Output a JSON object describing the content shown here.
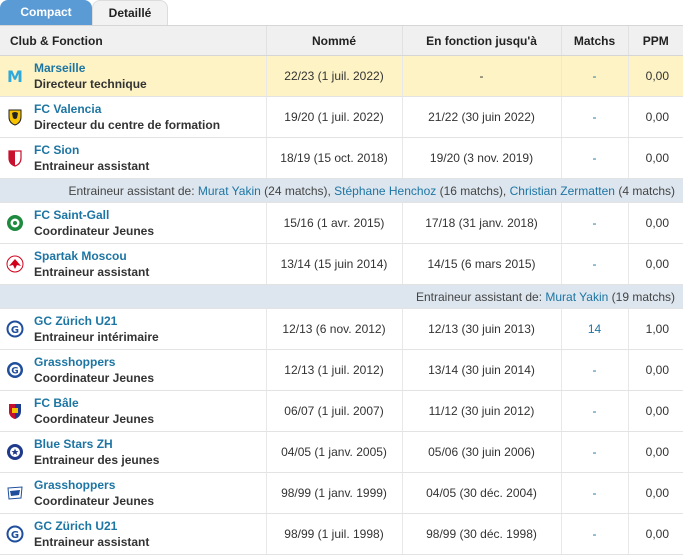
{
  "tabs": {
    "compact": "Compact",
    "detailed": "Detaillé"
  },
  "headers": {
    "club": "Club & Fonction",
    "appointed": "Nommé",
    "until": "En fonction jusqu'à",
    "matches": "Matchs",
    "ppm": "PPM"
  },
  "rows": [
    {
      "club": "Marseille",
      "function": "Directeur technique",
      "appointed": "22/23 (1 juil. 2022)",
      "until": "-",
      "matches": "-",
      "ppm": "0,00"
    },
    {
      "club": "FC Valencia",
      "function": "Directeur du centre de formation",
      "appointed": "19/20 (1 juil. 2022)",
      "until": "21/22 (30 juin 2022)",
      "matches": "-",
      "ppm": "0,00"
    },
    {
      "club": "FC Sion",
      "function": "Entraineur assistant",
      "appointed": "18/19 (15 oct. 2018)",
      "until": "19/20 (3 nov. 2019)",
      "matches": "-",
      "ppm": "0,00"
    },
    {
      "club": "FC Saint-Gall",
      "function": "Coordinateur Jeunes",
      "appointed": "15/16 (1 avr. 2015)",
      "until": "17/18 (31 janv. 2018)",
      "matches": "-",
      "ppm": "0,00"
    },
    {
      "club": "Spartak Moscou",
      "function": "Entraineur assistant",
      "appointed": "13/14 (15 juin 2014)",
      "until": "14/15 (6 mars 2015)",
      "matches": "-",
      "ppm": "0,00"
    },
    {
      "club": "GC Zürich U21",
      "function": "Entraineur intérimaire",
      "appointed": "12/13 (6 nov. 2012)",
      "until": "12/13 (30 juin 2013)",
      "matches": "14",
      "ppm": "1,00"
    },
    {
      "club": "Grasshoppers",
      "function": "Coordinateur Jeunes",
      "appointed": "12/13 (1 juil. 2012)",
      "until": "13/14 (30 juin 2014)",
      "matches": "-",
      "ppm": "0,00"
    },
    {
      "club": "FC Bâle",
      "function": "Coordinateur Jeunes",
      "appointed": "06/07 (1 juil. 2007)",
      "until": "11/12 (30 juin 2012)",
      "matches": "-",
      "ppm": "0,00"
    },
    {
      "club": "Blue Stars ZH",
      "function": "Entraineur des jeunes",
      "appointed": "04/05 (1 janv. 2005)",
      "until": "05/06 (30 juin 2006)",
      "matches": "-",
      "ppm": "0,00"
    },
    {
      "club": "Grasshoppers",
      "function": "Coordinateur Jeunes",
      "appointed": "98/99 (1 janv. 1999)",
      "until": "04/05 (30 déc. 2004)",
      "matches": "-",
      "ppm": "0,00"
    },
    {
      "club": "GC Zürich U21",
      "function": "Entraineur assistant",
      "appointed": "98/99 (1 juil. 1998)",
      "until": "98/99 (30 déc. 1998)",
      "matches": "-",
      "ppm": "0,00"
    }
  ],
  "info1": {
    "prefix": "Entraineur assistant de: ",
    "name1": "Murat Yakin",
    "count1": " (24 matchs), ",
    "name2": "Stéphane Henchoz",
    "count2": " (16 matchs), ",
    "name3": "Christian Zermatten",
    "count3": " (4 matchs)"
  },
  "info2": {
    "prefix": "Entraineur assistant de: ",
    "name1": "Murat Yakin",
    "count1": " (19 matchs)"
  },
  "colors": {
    "accent": "#5b9bd5",
    "link": "#1d75a3",
    "highlight": "#fdf3c4",
    "info_bg": "#dde6ee"
  }
}
